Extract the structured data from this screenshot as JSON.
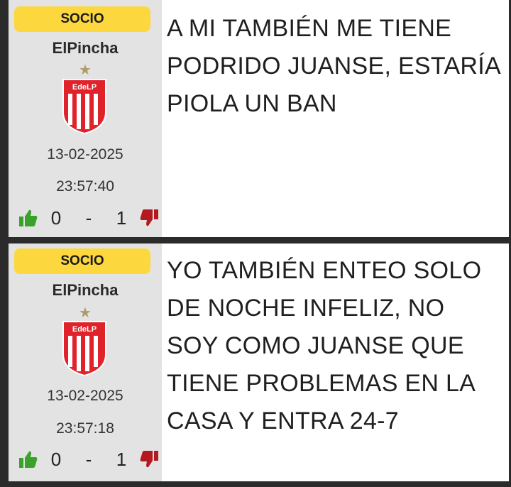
{
  "posts": [
    {
      "badge": "SOCIO",
      "username": "ElPincha",
      "star": "★",
      "crest_text": "EdeLP",
      "date": "13-02-2025",
      "time": "23:57:40",
      "likes": "0",
      "separator": "-",
      "dislikes": "1",
      "message": "A MI TAMBIÉN ME TIENE PODRIDO JUANSE, ESTARÍA PIOLA UN BAN"
    },
    {
      "badge": "SOCIO",
      "username": "ElPincha",
      "star": "★",
      "crest_text": "EdeLP",
      "date": "13-02-2025",
      "time": "23:57:18",
      "likes": "0",
      "separator": "-",
      "dislikes": "1",
      "message": "YO TAMBIÉN ENTEO SOLO DE NOCHE INFELIZ, NO SOY COMO JUANSE QUE TIENE PROBLEMAS EN LA CASA Y ENTRA 24-7"
    }
  ],
  "colors": {
    "badge": "#fcd83e",
    "sidebar": "#e3e3e3",
    "like": "#3aa12a",
    "dislike": "#b3191f",
    "crest_red": "#e0222b"
  },
  "icons": [
    "thumbs-up-icon",
    "thumbs-down-icon",
    "star-icon",
    "club-crest-icon"
  ]
}
